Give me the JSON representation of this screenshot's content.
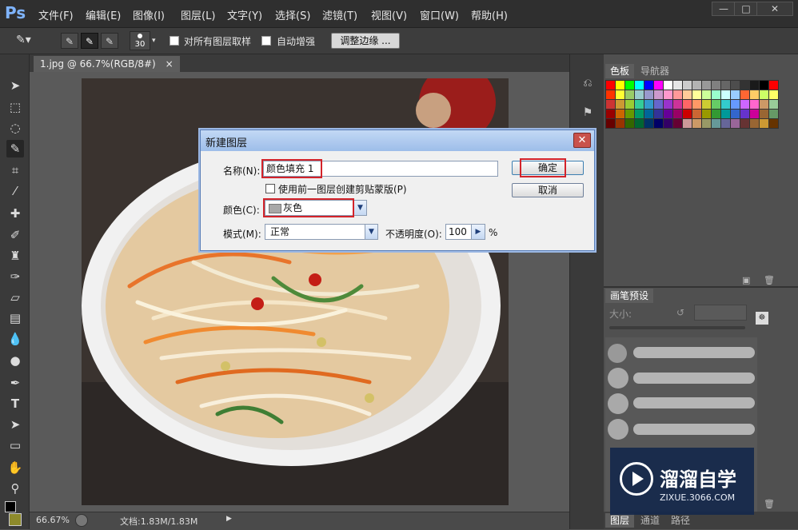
{
  "app": {
    "logo": "Ps"
  },
  "menu": [
    "文件(F)",
    "编辑(E)",
    "图像(I)",
    "图层(L)",
    "文字(Y)",
    "选择(S)",
    "滤镜(T)",
    "视图(V)",
    "窗口(W)",
    "帮助(H)"
  ],
  "window_controls": [
    "—",
    "□",
    "✕"
  ],
  "options_bar": {
    "brush_size": "30",
    "sample_all_layers": "对所有图层取样",
    "auto_enhance": "自动增强",
    "refine_edge": "调整边缘 ..."
  },
  "document": {
    "tab_label": "1.jpg @ 66.7%(RGB/8#)",
    "tab_close": "×",
    "zoom": "66.67%",
    "doc_size": "文档:1.83M/1.83M"
  },
  "panels": {
    "swatches_tab": "色板",
    "navigator_tab": "导航器",
    "brush_presets_tab": "画笔预设",
    "size_label": "大小:",
    "layers_tab": "图层",
    "channels_tab": "通道",
    "paths_tab": "路径",
    "swatch_colors": [
      "#ff0000",
      "#ffff00",
      "#00ff00",
      "#00ffff",
      "#0000ff",
      "#ff00ff",
      "#ffffff",
      "#e6e6e6",
      "#cccccc",
      "#b3b3b3",
      "#999999",
      "#808080",
      "#666666",
      "#4d4d4d",
      "#333333",
      "#1a1a1a",
      "#000000",
      "#ff0000",
      "#ff3300",
      "#ffff33",
      "#99cc66",
      "#99cccc",
      "#9999cc",
      "#cc99cc",
      "#ff99cc",
      "#ff9999",
      "#ffcc99",
      "#ffff99",
      "#ccff99",
      "#99ffcc",
      "#ccffff",
      "#99ccff",
      "#ff6633",
      "#ffcc66",
      "#ccff66",
      "#ffff66",
      "#cc3333",
      "#cc9933",
      "#99cc33",
      "#33cc99",
      "#3399cc",
      "#6666cc",
      "#9933cc",
      "#cc3399",
      "#ff6666",
      "#ff9966",
      "#cccc33",
      "#66cc66",
      "#33cccc",
      "#6699ff",
      "#cc66ff",
      "#ff66cc",
      "#cc9966",
      "#99cc99",
      "#990000",
      "#cc6600",
      "#669900",
      "#009966",
      "#006699",
      "#333399",
      "#660099",
      "#990066",
      "#cc0000",
      "#cc6633",
      "#999900",
      "#339933",
      "#009999",
      "#3366cc",
      "#6633cc",
      "#cc0099",
      "#996633",
      "#669966",
      "#660000",
      "#993300",
      "#336600",
      "#006633",
      "#003366",
      "#000066",
      "#330066",
      "#660033",
      "#cc9999",
      "#cc9966",
      "#999966",
      "#669999",
      "#666699",
      "#996699",
      "#663333",
      "#996633",
      "#cc9933",
      "#663300"
    ]
  },
  "dialog": {
    "title": "新建图层",
    "name_label": "名称(N):",
    "name_value": "颜色填充 1",
    "clip_label": "使用前一图层创建剪贴蒙版(P)",
    "color_label": "颜色(C):",
    "color_value": "灰色",
    "mode_label": "模式(M):",
    "mode_value": "正常",
    "opacity_label": "不透明度(O):",
    "opacity_value": "100",
    "opacity_unit": "%",
    "ok": "确定",
    "cancel": "取消",
    "close": "✕"
  },
  "watermark": {
    "brand": "溜溜自学",
    "url": "ZIXUE.3066.COM"
  }
}
